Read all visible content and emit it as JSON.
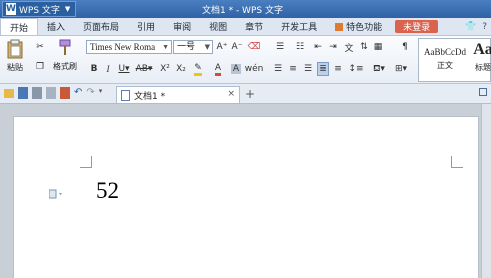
{
  "app": {
    "name": "WPS 文字",
    "window_title": "文档1 * - WPS 文字"
  },
  "menu": {
    "tabs": [
      "开始",
      "插入",
      "页面布局",
      "引用",
      "审阅",
      "视图",
      "章节",
      "开发工具",
      "特色功能"
    ],
    "login_label": "未登录"
  },
  "ribbon": {
    "paste_label": "粘贴",
    "format_painter_label": "格式刷",
    "font_name": "Times New Roma",
    "font_size": "一号",
    "styles": [
      {
        "sample": "AaBbCcDd",
        "label": "正文"
      },
      {
        "sample": "Aa",
        "label": "标题"
      }
    ]
  },
  "doc_tab": {
    "title": "文档1 *"
  },
  "document": {
    "text": "52"
  },
  "colors": {
    "title_bar": "#2f62a6",
    "login_button": "#d9634d",
    "highlight": "#f1c40f",
    "font_color": "#d64a3a"
  }
}
